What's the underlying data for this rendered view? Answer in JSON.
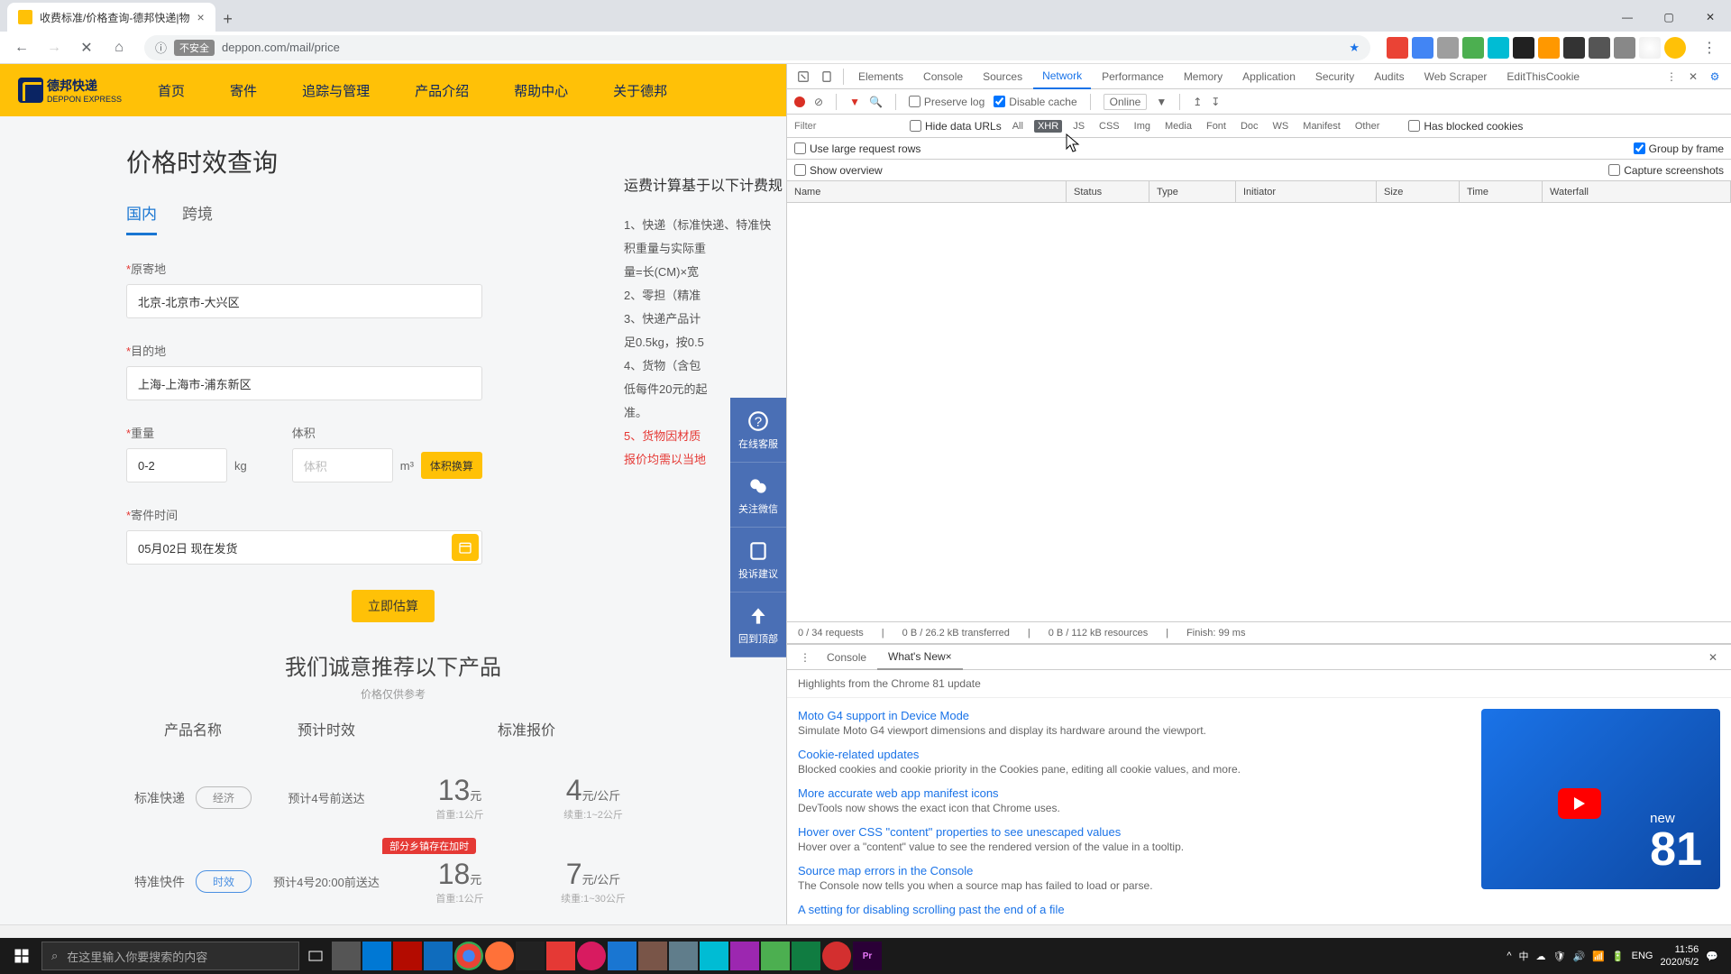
{
  "browser": {
    "tab_title": "收费标准/价格查询-德邦快递|物",
    "url_prefix": "不安全",
    "url": "deppon.com/mail/price"
  },
  "site": {
    "logo_text": "德邦快递",
    "logo_sub": "DEPPON EXPRESS",
    "nav": [
      "首页",
      "寄件",
      "追踪与管理",
      "产品介绍",
      "帮助中心",
      "关于德邦"
    ]
  },
  "page": {
    "title": "价格时效查询",
    "tabs": [
      "国内",
      "跨境"
    ],
    "form": {
      "origin_label": "原寄地",
      "origin_value": "北京-北京市-大兴区",
      "dest_label": "目的地",
      "dest_value": "上海-上海市-浦东新区",
      "weight_label": "重量",
      "weight_value": "0-2",
      "weight_unit": "kg",
      "volume_label": "体积",
      "volume_placeholder": "体积",
      "volume_unit": "m³",
      "volume_calc": "体积换算",
      "date_label": "寄件时间",
      "date_value": "05月02日 现在发货",
      "submit": "立即估算"
    },
    "rules": {
      "title": "运费计算基于以下计费规",
      "r1": "1、快递（标准快递、特准快",
      "r1b": "积重量与实际重",
      "r1c": "量=长(CM)×宽",
      "r2": "2、零担（精准",
      "r3": "3、快递产品计",
      "r3b": "足0.5kg，按0.5",
      "r4": "4、货物（含包",
      "r4b": "低每件20元的起",
      "r4c": "准。",
      "r5": "5、货物因材质",
      "r5b": "报价均需以当地"
    },
    "float": [
      "在线客服",
      "关注微信",
      "投诉建议",
      "回到顶部"
    ],
    "recommend_title": "我们诚意推荐以下产品",
    "recommend_sub": "价格仅供参考",
    "columns": [
      "产品名称",
      "预计时效",
      "标准报价"
    ],
    "products": [
      {
        "name": "标准快递",
        "badge": "经济",
        "eta": "预计4号前送达",
        "price": "13",
        "unit": "元",
        "psub": "首重:1公斤",
        "rate": "4",
        "runit": "元/公斤",
        "rsub": "续重:1~2公斤"
      },
      {
        "name": "特准快件",
        "badge": "时效",
        "eta": "预计4号20:00前送达",
        "stock": "部分乡镇存在加时",
        "price": "18",
        "unit": "元",
        "psub": "首重:1公斤",
        "rate": "7",
        "runit": "元/公斤",
        "rsub": "续重:1~30公斤"
      }
    ]
  },
  "devtools": {
    "tabs": [
      "Elements",
      "Console",
      "Sources",
      "Network",
      "Performance",
      "Memory",
      "Application",
      "Security",
      "Audits",
      "Web Scraper",
      "EditThisCookie"
    ],
    "active_tab": "Network",
    "toolbar": {
      "preserve": "Preserve log",
      "disable": "Disable cache",
      "online": "Online"
    },
    "filter": {
      "placeholder": "Filter",
      "hide": "Hide data URLs",
      "tags": [
        "All",
        "XHR",
        "JS",
        "CSS",
        "Img",
        "Media",
        "Font",
        "Doc",
        "WS",
        "Manifest",
        "Other"
      ],
      "active": "XHR",
      "blocked": "Has blocked cookies"
    },
    "opts": {
      "large": "Use large request rows",
      "group": "Group by frame",
      "overview": "Show overview",
      "capture": "Capture screenshots"
    },
    "columns": [
      "Name",
      "Status",
      "Type",
      "Initiator",
      "Size",
      "Time",
      "Waterfall"
    ],
    "status": [
      "0 / 34 requests",
      "0 B / 26.2 kB transferred",
      "0 B / 112 kB resources",
      "Finish: 99 ms"
    ],
    "drawer_tabs": [
      "Console",
      "What's New"
    ],
    "highlights": "Highlights from the Chrome 81 update",
    "news": [
      {
        "t": "Moto G4 support in Device Mode",
        "d": "Simulate Moto G4 viewport dimensions and display its hardware around the viewport."
      },
      {
        "t": "Cookie-related updates",
        "d": "Blocked cookies and cookie priority in the Cookies pane, editing all cookie values, and more."
      },
      {
        "t": "More accurate web app manifest icons",
        "d": "DevTools now shows the exact icon that Chrome uses."
      },
      {
        "t": "Hover over CSS \"content\" properties to see unescaped values",
        "d": "Hover over a \"content\" value to see the rendered version of the value in a tooltip."
      },
      {
        "t": "Source map errors in the Console",
        "d": "The Console now tells you when a source map has failed to load or parse."
      },
      {
        "t": "A setting for disabling scrolling past the end of a file",
        "d": ""
      }
    ],
    "news_new": "new",
    "news_81": "81"
  },
  "taskbar": {
    "search_placeholder": "在这里输入你要搜索的内容",
    "ime": "中",
    "lang": "ENG",
    "time": "11:56",
    "date": "2020/5/2"
  }
}
